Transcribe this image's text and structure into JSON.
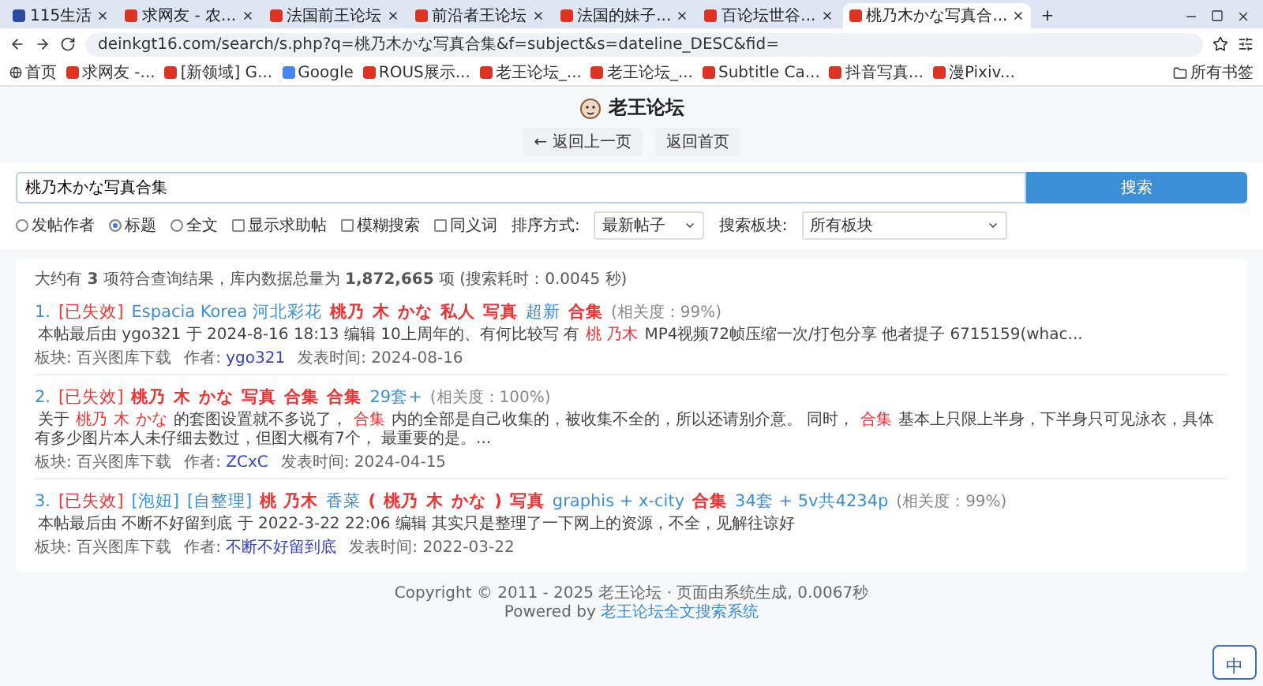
{
  "browser": {
    "tabs": [
      {
        "label": "115生活",
        "selected": false
      },
      {
        "label": "求网友 - 农...",
        "selected": false
      },
      {
        "label": "法国前王论坛",
        "selected": false
      },
      {
        "label": "前沿者王论坛",
        "selected": false
      },
      {
        "label": "法国的妹子...",
        "selected": false
      },
      {
        "label": "百论坛世谷...",
        "selected": false
      },
      {
        "label": "桃乃木かな写真合...",
        "selected": true
      }
    ],
    "new_tab": "+",
    "address": "deinkgt16.com/search/s.php?q=桃乃木かな写真合集&f=subject&s=dateline_DESC&fid=",
    "bookmarks": [
      {
        "label": "首页"
      },
      {
        "label": "求网友 -..."
      },
      {
        "label": "[新领域] G..."
      },
      {
        "label": "Google"
      },
      {
        "label": "ROUS展示..."
      },
      {
        "label": "老王论坛_..."
      },
      {
        "label": "老王论坛_..."
      },
      {
        "label": "Subtitle Ca..."
      },
      {
        "label": "抖音写真..."
      },
      {
        "label": "漫Pixiv..."
      }
    ],
    "all_bookmarks": "所有书签"
  },
  "header": {
    "site_name": "老王论坛",
    "nav": [
      "← 返回上一页",
      "返回首页"
    ]
  },
  "search": {
    "value": "桃乃木かな写真合集",
    "button": "搜索",
    "scopes": [
      {
        "label": "发帖作者",
        "selected": false
      },
      {
        "label": "标题",
        "selected": true
      },
      {
        "label": "全文",
        "selected": false
      }
    ],
    "options": [
      {
        "label": "显示求助帖",
        "checked": false
      },
      {
        "label": "模糊搜索",
        "checked": false
      },
      {
        "label": "同义词",
        "checked": false
      }
    ],
    "sort_label": "排序方式:",
    "sort_value": "最新帖子",
    "board_label": "搜索板块:",
    "board_value": "所有板块"
  },
  "results": {
    "summary": "大约有 **3** 项符合查询结果，库内数据总量为 **1,872,665** 项 (搜索耗时：0.0045 秒)",
    "items": [
      {
        "index": "1.",
        "title": [
          {
            "kind": "tag",
            "text": "[已失效]"
          },
          {
            "kind": "plain",
            "text": "Espacia Korea 河北彩花"
          },
          {
            "kind": "match",
            "text": "桃乃"
          },
          {
            "kind": "match",
            "text": "木"
          },
          {
            "kind": "match",
            "text": "かな"
          },
          {
            "kind": "match",
            "text": "私人"
          },
          {
            "kind": "match",
            "text": "写真"
          },
          {
            "kind": "plain",
            "text": "超新"
          },
          {
            "kind": "match",
            "text": "合集"
          }
        ],
        "relevance": "(相关度：99%)",
        "snippet": [
          {
            "kind": "plain",
            "text": "本帖最后由 ygo321 于 2024-8-16 18:13 编辑 10上周年的、有何比较写 有"
          },
          {
            "kind": "match",
            "text": "桃 乃木"
          },
          {
            "kind": "plain",
            "text": "MP4视频72帧压缩一次/打包分享 他者提子 6715159(whac..."
          }
        ],
        "board_label": "板块:",
        "board": "百兴图库下载",
        "author_label": "作者:",
        "author": "ygo321",
        "time_label": "发表时间:",
        "time": "2024-08-16"
      },
      {
        "index": "2.",
        "title": [
          {
            "kind": "tag",
            "text": "[已失效]"
          },
          {
            "kind": "match",
            "text": "桃乃"
          },
          {
            "kind": "match",
            "text": "木"
          },
          {
            "kind": "match",
            "text": "かな"
          },
          {
            "kind": "match",
            "text": "写真"
          },
          {
            "kind": "match",
            "text": "合集"
          },
          {
            "kind": "match",
            "text": "合集"
          },
          {
            "kind": "plain",
            "text": "29套+"
          }
        ],
        "relevance": "(相关度：100%)",
        "snippet": [
          {
            "kind": "plain",
            "text": "关于"
          },
          {
            "kind": "match",
            "text": "桃乃"
          },
          {
            "kind": "match",
            "text": "木"
          },
          {
            "kind": "match",
            "text": "かな"
          },
          {
            "kind": "plain",
            "text": "的套图设置就不多说了，"
          },
          {
            "kind": "match",
            "text": "合集"
          },
          {
            "kind": "plain",
            "text": "内的全部是自己收集的，被收集不全的，所以还请别介意。 同时，"
          },
          {
            "kind": "match",
            "text": "合集"
          },
          {
            "kind": "plain",
            "text": "基本上只限上半身，下半身只可见泳衣，具体有多少图片本人未仔细去数过，但图大概有7个， 最重要的是。..."
          }
        ],
        "board_label": "板块:",
        "board": "百兴图库下载",
        "author_label": "作者:",
        "author": "ZCxC",
        "time_label": "发表时间:",
        "time": "2024-04-15"
      },
      {
        "index": "3.",
        "title": [
          {
            "kind": "tag",
            "text": "[已失效]"
          },
          {
            "kind": "plain",
            "text": "[泡妞]"
          },
          {
            "kind": "plain",
            "text": "[自整理]"
          },
          {
            "kind": "match",
            "text": "桃 乃木"
          },
          {
            "kind": "plain",
            "text": "香菜"
          },
          {
            "kind": "match",
            "text": "("
          },
          {
            "kind": "match",
            "text": "桃乃"
          },
          {
            "kind": "match",
            "text": "木"
          },
          {
            "kind": "match",
            "text": "かな"
          },
          {
            "kind": "match",
            "text": ")"
          },
          {
            "kind": "match",
            "text": "写真"
          },
          {
            "kind": "plain",
            "text": "graphis + x-city"
          },
          {
            "kind": "match",
            "text": "合集"
          },
          {
            "kind": "plain",
            "text": "34套 + 5v共4234p"
          }
        ],
        "relevance": "(相关度：99%)",
        "snippet": [
          {
            "kind": "plain",
            "text": "本帖最后由 不断不好留到底 于 2022-3-22 22:06 编辑 其实只是整理了一下网上的资源，不全，见解往谅好"
          }
        ],
        "board_label": "板块:",
        "board": "百兴图库下载",
        "author_label": "作者:",
        "author": "不断不好留到底",
        "time_label": "发表时间:",
        "time": "2022-03-22"
      }
    ]
  },
  "footer": {
    "copyright": "Copyright © 2011 - 2025 老王论坛 · 页面由系统生成, 0.0067秒",
    "powered_prefix": "Powered by",
    "powered_link": "老王论坛全文搜索系统"
  },
  "ime": {
    "label": "中"
  }
}
